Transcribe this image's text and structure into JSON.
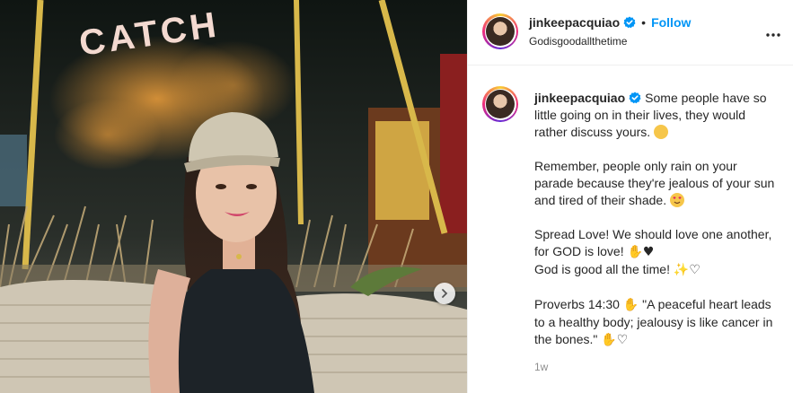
{
  "post": {
    "username": "jinkeepacquiao",
    "subtitle": "Godisgoodallthetime",
    "follow_label": "Follow",
    "separator": "•",
    "caption": {
      "username": "jinkeepacquiao",
      "p1": "Some people have so little going on in their lives, they would rather discuss yours.",
      "p2": "Remember, people only rain on your parade because they're jealous of your sun and tired of their shade.",
      "p3a": "Spread Love! We should love one another, for GOD is love!",
      "p3b": "God is good all the time!",
      "p4a": "Proverbs 14:30",
      "p4b": "\"A peaceful heart leads to a healthy body; jealousy is like cancer in the bones.\""
    },
    "time": "1w"
  },
  "photo": {
    "sign_text": "CATCH"
  },
  "icons": {
    "verified": "verified-badge-icon",
    "more": "more-options-icon",
    "next": "chevron-right-icon"
  },
  "colors": {
    "accent": "#0095f6",
    "text": "#262626",
    "muted": "#8e8e8e"
  }
}
